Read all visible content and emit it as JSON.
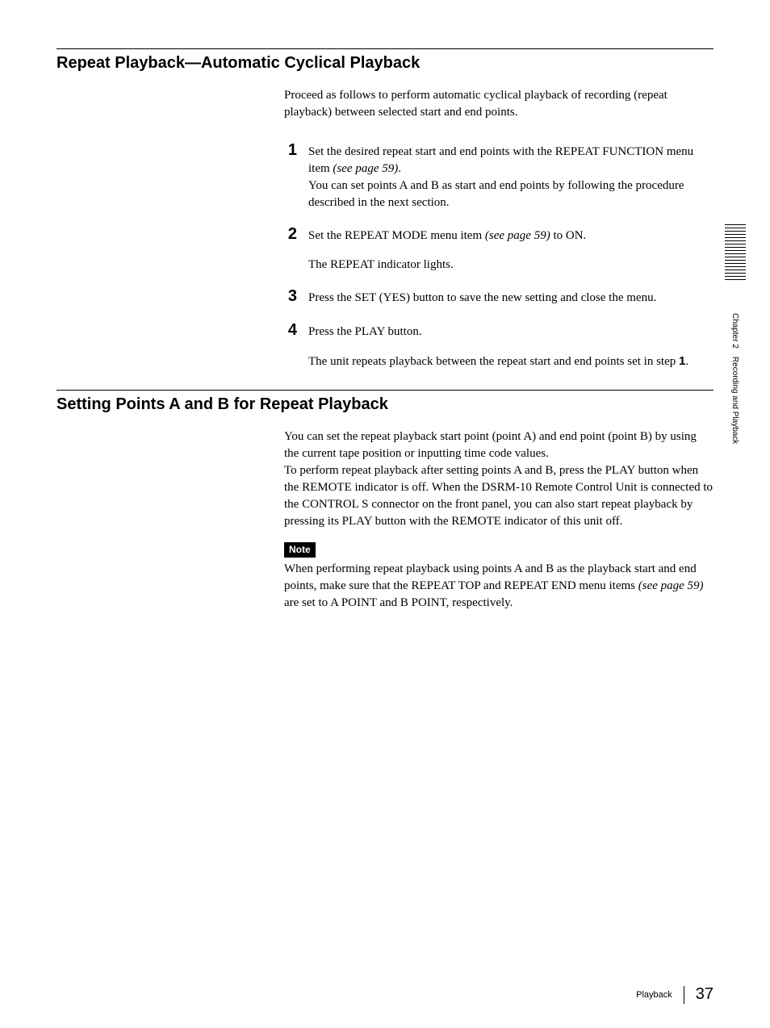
{
  "section1": {
    "title": "Repeat Playback—Automatic Cyclical Playback",
    "intro": "Proceed as follows to perform automatic cyclical playback of recording (repeat playback) between selected start and end points.",
    "steps": [
      {
        "num": "1",
        "body_a": "Set the desired repeat start and end points with the REPEAT FUNCTION menu item ",
        "ref": "(see page 59)",
        "body_b": ".",
        "extra": "You can set points A and B as start and end points by following the procedure described in the next section.",
        "result": ""
      },
      {
        "num": "2",
        "body_a": "Set the REPEAT MODE menu item ",
        "ref": "(see page 59)",
        "body_b": " to ON.",
        "extra": "",
        "result": "The REPEAT indicator lights."
      },
      {
        "num": "3",
        "body_a": "Press the SET (YES) button to save the new setting and close the menu.",
        "ref": "",
        "body_b": "",
        "extra": "",
        "result": ""
      },
      {
        "num": "4",
        "body_a": "Press the PLAY button.",
        "ref": "",
        "body_b": "",
        "extra": "",
        "result_a": "The unit repeats playback between the repeat start and end points set in step ",
        "result_bold": "1",
        "result_b": "."
      }
    ]
  },
  "section2": {
    "title": "Setting Points A and B for Repeat Playback",
    "para": "You can set the repeat playback start point (point A) and end point (point B) by using the current tape position or inputting time code values.\nTo perform repeat playback after setting points A and B, press the PLAY button when the REMOTE indicator is off. When the DSRM-10 Remote Control Unit is connected to the CONTROL S connector on the front panel, you can also start repeat playback by pressing its PLAY button with the REMOTE indicator of this unit off.",
    "note_label": "Note",
    "note_a": "When performing repeat playback using points A and B as the playback start and end points, make sure that the REPEAT TOP and REPEAT END menu items ",
    "note_ref": "(see page 59)",
    "note_b": " are set to A POINT and B POINT, respectively."
  },
  "side_label": "Chapter 2 Recording and Playback",
  "footer": {
    "section": "Playback",
    "page": "37"
  }
}
